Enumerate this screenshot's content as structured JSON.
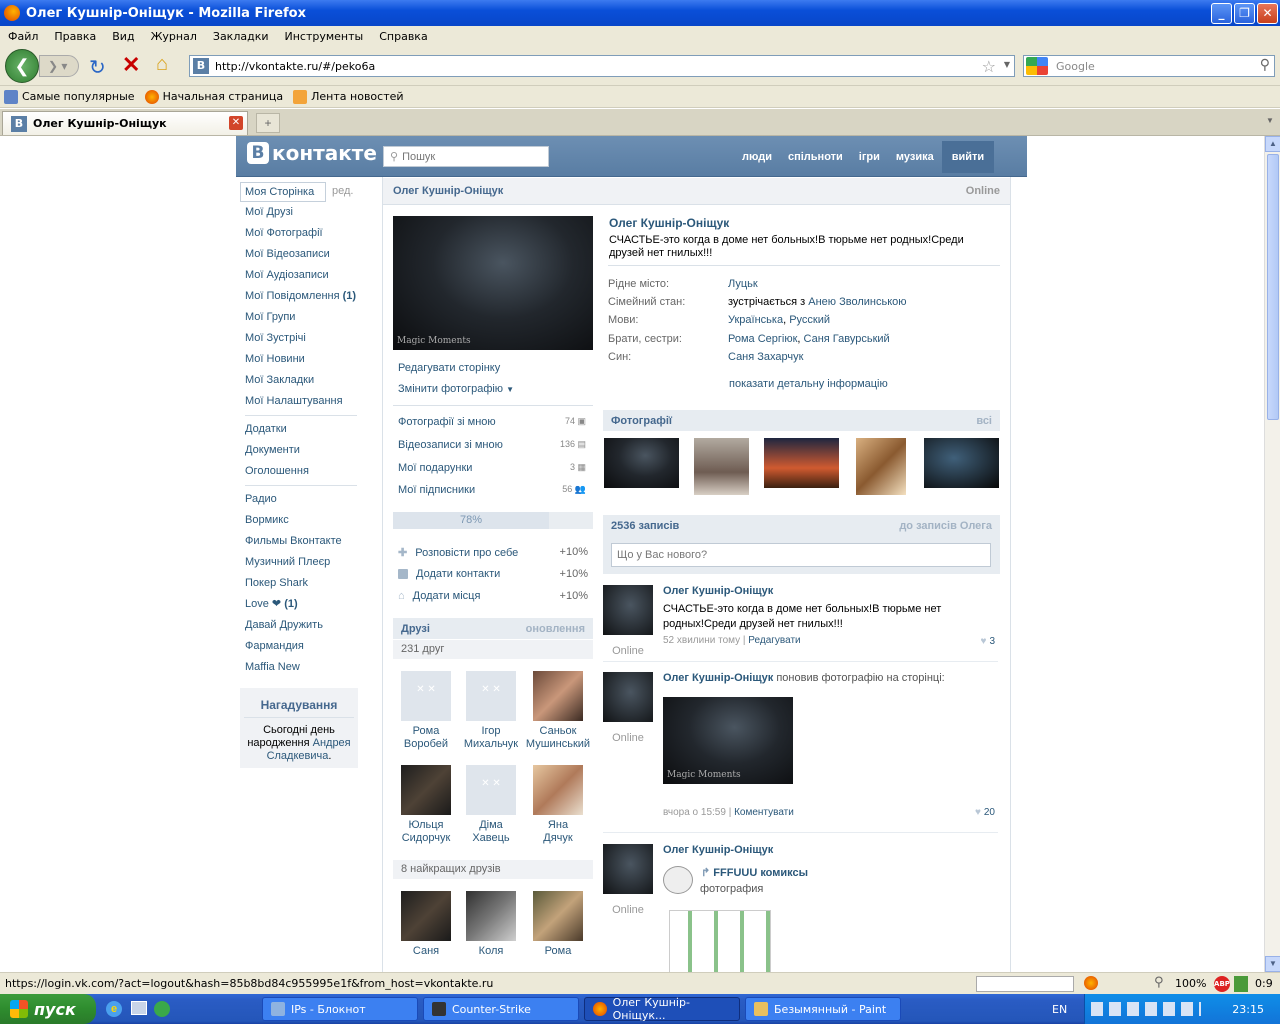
{
  "window": {
    "title": "Олег Кушнір-Оніщук - Mozilla Firefox"
  },
  "menu": [
    "Файл",
    "Правка",
    "Вид",
    "Журнал",
    "Закладки",
    "Инструменты",
    "Справка"
  ],
  "browser": {
    "url": "http://vkontakte.ru/#/peko6a",
    "search_placeholder": "Google"
  },
  "bookmarks": [
    "Самые популярные",
    "Начальная страница",
    "Лента новостей"
  ],
  "tab": {
    "label": "Олег Кушнір-Оніщук"
  },
  "vk": {
    "logo": "контакте",
    "search_placeholder": "Пошук",
    "nav": [
      "люди",
      "спільноти",
      "ігри",
      "музика",
      "вийти"
    ]
  },
  "left_menu": {
    "my_page": "Моя Сторінка",
    "edit": "ред.",
    "group1": [
      "Мої Друзі",
      "Мої Фотографії",
      "Мої Відеозаписи",
      "Мої Аудіозаписи",
      "Мої Повідомлення",
      "Мої Групи",
      "Мої Зустрічі",
      "Мої Новини",
      "Мої Закладки",
      "Мої Налаштування"
    ],
    "messages_count": "(1)",
    "group2": [
      "Додатки",
      "Документи",
      "Оголошення"
    ],
    "group3": [
      "Радио",
      "Вормикс",
      "Фильмы Вконтакте",
      "Музичний Плеєр",
      "Покер Shark",
      "Love ❤",
      "Давай Дружить",
      "Фармандия",
      "Maffia New"
    ],
    "love_count": "(1)"
  },
  "reminder": {
    "title": "Нагадування",
    "text": "Сьогодні день народження",
    "name": "Андрея Сладкевича",
    "dot": "."
  },
  "profile": {
    "header_name": "Олег Кушнір-Оніщук",
    "online": "Online",
    "name": "Олег Кушнір-Оніщук",
    "status": "СЧАСТЬЕ-это когда в доме нет больных!В тюрьме нет родных!Среди друзей нет гнилых!!!",
    "photo_caption": "Magic Moments",
    "actions": [
      "Редагувати сторінку",
      "Змінити фотографію"
    ],
    "counts": [
      {
        "label": "Фотографії зі мною",
        "value": "74"
      },
      {
        "label": "Відеозаписи зі мною",
        "value": "136"
      },
      {
        "label": "Мої подарунки",
        "value": "3"
      },
      {
        "label": "Мої підписники",
        "value": "56"
      }
    ],
    "completion": "78%",
    "completion_value": 0.78,
    "add": [
      {
        "label": "Розповісти про себе",
        "value": "+10%"
      },
      {
        "label": "Додати контакти",
        "value": "+10%"
      },
      {
        "label": "Додати місця",
        "value": "+10%"
      }
    ],
    "info": {
      "hometown_k": "Рідне місто:",
      "hometown_v": "Луцьк",
      "family_k": "Сімейний стан:",
      "family_pre": "зустрічається з ",
      "family_v": "Анею Зволинською",
      "lang_k": "Мови:",
      "lang_v1": "Українська",
      "lang_v2": "Русский",
      "sib_k": "Брати, сестри:",
      "sib_v1": "Рома Сергіюк",
      "sib_v2": "Саня Гавурський",
      "son_k": "Син:",
      "son_v": "Саня Захарчук",
      "more": "показати детальну інформацію"
    }
  },
  "friends": {
    "title": "Друзі",
    "updates": "оновлення",
    "count": "231 друг",
    "list": [
      {
        "first": "Рома",
        "last": "Воробей"
      },
      {
        "first": "Ігор",
        "last": "Михальчук"
      },
      {
        "first": "Саньок",
        "last": "Мушинський"
      },
      {
        "first": "Юльця",
        "last": "Сидорчук"
      },
      {
        "first": "Діма",
        "last": "Хавець"
      },
      {
        "first": "Яна",
        "last": "Дячук"
      }
    ],
    "best_title": "8 найкращих друзів",
    "best": [
      "Саня",
      "Коля",
      "Рома"
    ]
  },
  "photos": {
    "title": "Фотографії",
    "all": "всі"
  },
  "wall": {
    "count": "2536 записів",
    "to": "до записів Олега",
    "placeholder": "Що у Вас нового?",
    "posts": [
      {
        "name": "Олег Кушнір-Оніщук",
        "text": "СЧАСТЬЕ-это когда в доме нет больных!В тюрьме нет родных!Среди друзей нет гнилых!!!",
        "time": "52 хвилини тому",
        "sep": "|",
        "action": "Редагувати",
        "likes": "3",
        "online": "Online"
      },
      {
        "name": "Олег Кушнір-Оніщук",
        "text": "поновив фотографію на сторінці:",
        "time": "вчора о 15:59",
        "sep": "|",
        "action": "Коментувати",
        "likes": "20",
        "online": "Online",
        "caption": "Magic Moments"
      },
      {
        "name": "Олег Кушнір-Оніщук",
        "repost": "FFFUUU комиксы",
        "sub": "фотография",
        "online": "Online"
      }
    ]
  },
  "statusbar": {
    "text": "https://login.vk.com/?act=logout&hash=85b8bd84c955995e1f&from_host=vkontakte.ru",
    "zoom": "100%",
    "counter": "0:9"
  },
  "taskbar": {
    "start": "пуск",
    "items": [
      "IPs - Блокнот",
      "Counter-Strike",
      "Олег Кушнір-Оніщук...",
      "Безымянный - Paint"
    ],
    "lang": "EN",
    "time": "23:15"
  }
}
